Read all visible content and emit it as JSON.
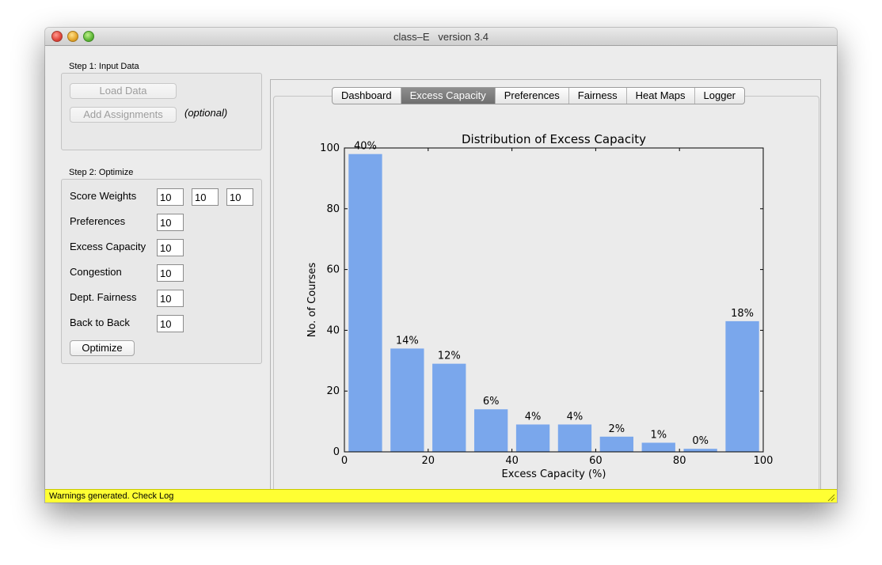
{
  "window": {
    "title": "class–E   version 3.4"
  },
  "step1": {
    "label": "Step 1: Input Data",
    "load_button": "Load Data",
    "add_assignments_button": "Add Assignments",
    "optional_label": "(optional)"
  },
  "step2": {
    "label": "Step 2: Optimize",
    "score_weights_label": "Score Weights",
    "score_weights": [
      "10",
      "10",
      "10"
    ],
    "fields": [
      {
        "label": "Preferences",
        "value": "10"
      },
      {
        "label": "Excess Capacity",
        "value": "10"
      },
      {
        "label": "Congestion",
        "value": "10"
      },
      {
        "label": "Dept. Fairness",
        "value": "10"
      },
      {
        "label": "Back to Back",
        "value": "10"
      }
    ],
    "optimize_button": "Optimize"
  },
  "tabs": [
    {
      "label": "Dashboard",
      "selected": false
    },
    {
      "label": "Excess Capacity",
      "selected": true
    },
    {
      "label": "Preferences",
      "selected": false
    },
    {
      "label": "Fairness",
      "selected": false
    },
    {
      "label": "Heat Maps",
      "selected": false
    },
    {
      "label": "Logger",
      "selected": false
    }
  ],
  "chart_data": {
    "type": "bar",
    "title": "Distribution of Excess Capacity",
    "xlabel": "Excess Capacity (%)",
    "ylabel": "No. of Courses",
    "x": [
      5,
      15,
      25,
      35,
      45,
      55,
      65,
      75,
      85,
      95
    ],
    "values": [
      98,
      34,
      29,
      14,
      9,
      9,
      5,
      3,
      1,
      43
    ],
    "bar_labels": [
      "40%",
      "14%",
      "12%",
      "6%",
      "4%",
      "4%",
      "2%",
      "1%",
      "0%",
      "18%"
    ],
    "bar_width": 8,
    "xlim": [
      0,
      100
    ],
    "ylim": [
      0,
      100
    ],
    "xticks": [
      0,
      20,
      40,
      60,
      80,
      100
    ],
    "yticks": [
      0,
      20,
      40,
      60,
      80,
      100
    ],
    "grid": false,
    "bar_color": "#7aa7ec"
  },
  "status": {
    "text": "Warnings generated. Check Log",
    "color": "#ffff33"
  }
}
